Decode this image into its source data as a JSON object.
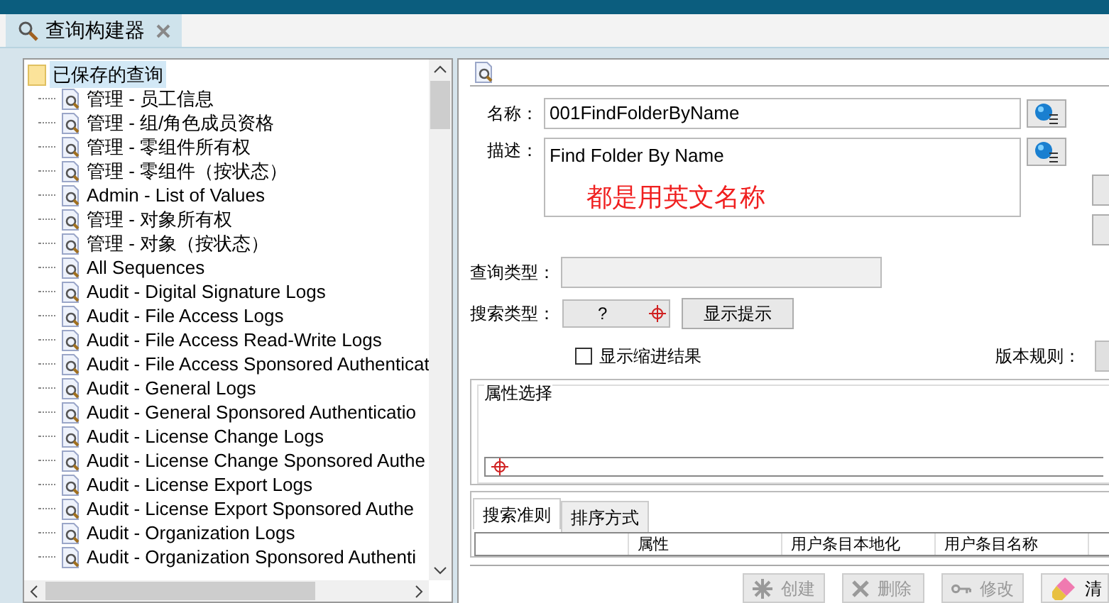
{
  "tab": {
    "title": "查询构建器",
    "selected": true
  },
  "tree": {
    "root": "已保存的查询",
    "expanded": true,
    "children": [
      {
        "label": "管理 - 员工信息"
      },
      {
        "label": "管理 - 组/角色成员资格"
      },
      {
        "label": "管理 - 零组件所有权"
      },
      {
        "label": "管理 - 零组件（按状态）"
      },
      {
        "label": "Admin - List of Values"
      },
      {
        "label": "管理 - 对象所有权"
      },
      {
        "label": "管理 - 对象（按状态）"
      },
      {
        "label": "All Sequences"
      },
      {
        "label": "Audit - Digital Signature Logs"
      },
      {
        "label": "Audit - File Access Logs"
      },
      {
        "label": "Audit - File Access Read-Write Logs"
      },
      {
        "label": "Audit - File Access Sponsored Authenticat"
      },
      {
        "label": "Audit - General Logs"
      },
      {
        "label": "Audit - General Sponsored Authenticatio"
      },
      {
        "label": "Audit - License Change Logs"
      },
      {
        "label": "Audit - License Change Sponsored Authe"
      },
      {
        "label": "Audit - License Export Logs"
      },
      {
        "label": "Audit - License Export Sponsored Authe"
      },
      {
        "label": "Audit - Organization Logs"
      },
      {
        "label": "Audit - Organization Sponsored Authenti"
      }
    ]
  },
  "form": {
    "name_label": "名称：",
    "name_value": "001FindFolderByName",
    "desc_label": "描述：",
    "desc_value": "Find Folder By Name",
    "annotation": "都是用英文名称",
    "query_type_label": "查询类型：",
    "search_type_label": "搜索类型：",
    "search_type_value": "?",
    "show_hint_button": "显示提示",
    "indent_checkbox": {
      "label": "显示缩进结果",
      "checked": false
    },
    "revision_rule_label": "版本规则："
  },
  "attribute_group": {
    "title": "属性选择"
  },
  "bottom_tabs": [
    {
      "label": "搜索准则",
      "selected": true
    },
    {
      "label": "排序方式",
      "selected": false
    }
  ],
  "table": {
    "columns": [
      "属性",
      "用户条目本地化",
      "用户条目名称"
    ]
  },
  "actions": [
    {
      "label": "创建",
      "disabled": true,
      "kind": "create"
    },
    {
      "label": "删除",
      "disabled": true,
      "kind": "delete"
    },
    {
      "label": "修改",
      "disabled": true,
      "kind": "modify"
    },
    {
      "label": "清",
      "disabled": false,
      "kind": "clear"
    }
  ]
}
